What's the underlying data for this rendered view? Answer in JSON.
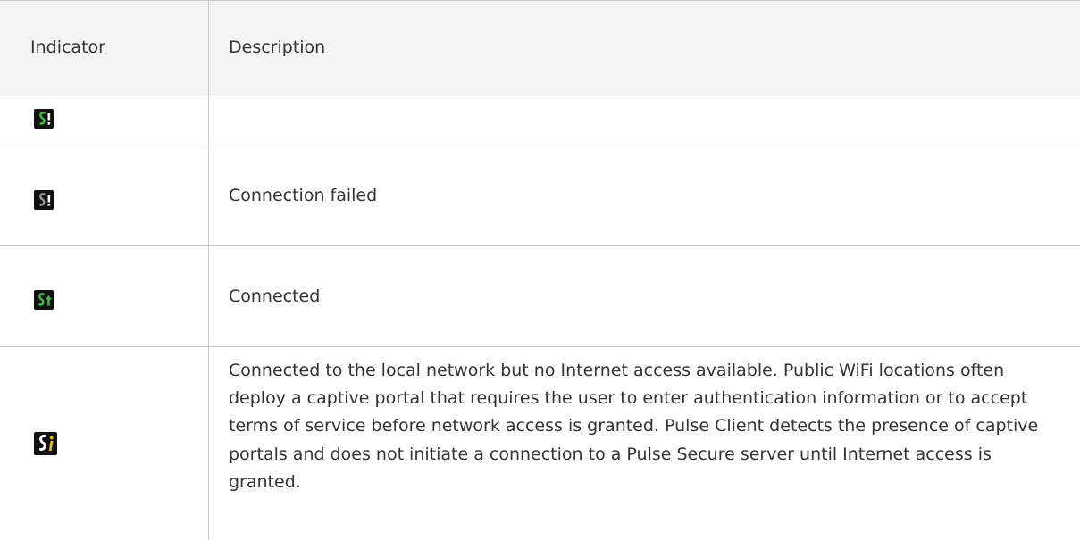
{
  "table": {
    "header": {
      "indicator": "Indicator",
      "description": "Description"
    },
    "rows": [
      {
        "icon": "pulse-alert-green-icon",
        "description": ""
      },
      {
        "icon": "pulse-alert-gray-icon",
        "description": "Connection failed"
      },
      {
        "icon": "pulse-connected-icon",
        "description": "Connected"
      },
      {
        "icon": "pulse-captive-portal-icon",
        "description": "Connected to the local network but no Internet access available. Public WiFi locations often deploy a captive portal that requires the user to enter authentication information or to accept terms of service before network access is granted. Pulse Client detects the presence of captive portals and does not initiate a connection to a Pulse Secure server until Internet access is granted."
      }
    ]
  },
  "colors": {
    "header_bg": "#f4f4f4",
    "border": "#c8c8c8",
    "text": "#333333",
    "icon_bg": "#121212",
    "icon_green": "#3fbf3f",
    "icon_gray": "#9a9a9a",
    "icon_yellow": "#e6c200"
  }
}
